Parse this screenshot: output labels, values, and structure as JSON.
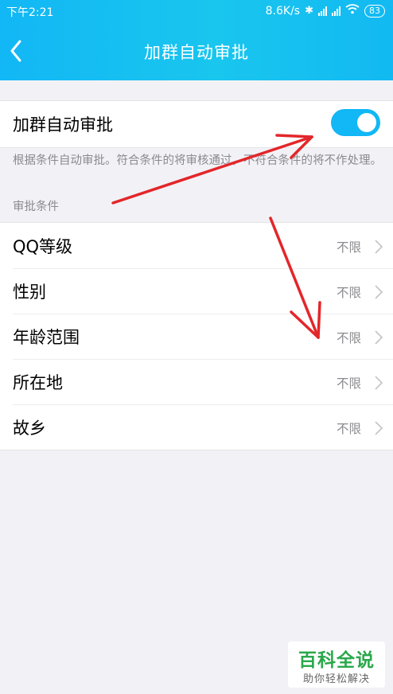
{
  "status_bar": {
    "time": "下午2:21",
    "network_speed": "8.6K/s",
    "battery": "83"
  },
  "header": {
    "title": "加群自动审批"
  },
  "toggle": {
    "label": "加群自动审批",
    "on": true
  },
  "description": "根据条件自动审批。符合条件的将审核通过，不符合条件的将不作处理。",
  "section_label": "审批条件",
  "conditions": [
    {
      "label": "QQ等级",
      "value": "不限"
    },
    {
      "label": "性别",
      "value": "不限"
    },
    {
      "label": "年龄范围",
      "value": "不限"
    },
    {
      "label": "所在地",
      "value": "不限"
    },
    {
      "label": "故乡",
      "value": "不限"
    }
  ],
  "watermark": {
    "title": "百科全说",
    "subtitle": "助你轻松解决"
  },
  "colors": {
    "accent": "#12b7f5",
    "annotation_arrow": "#e3262a",
    "watermark_green": "#2aa84a"
  }
}
